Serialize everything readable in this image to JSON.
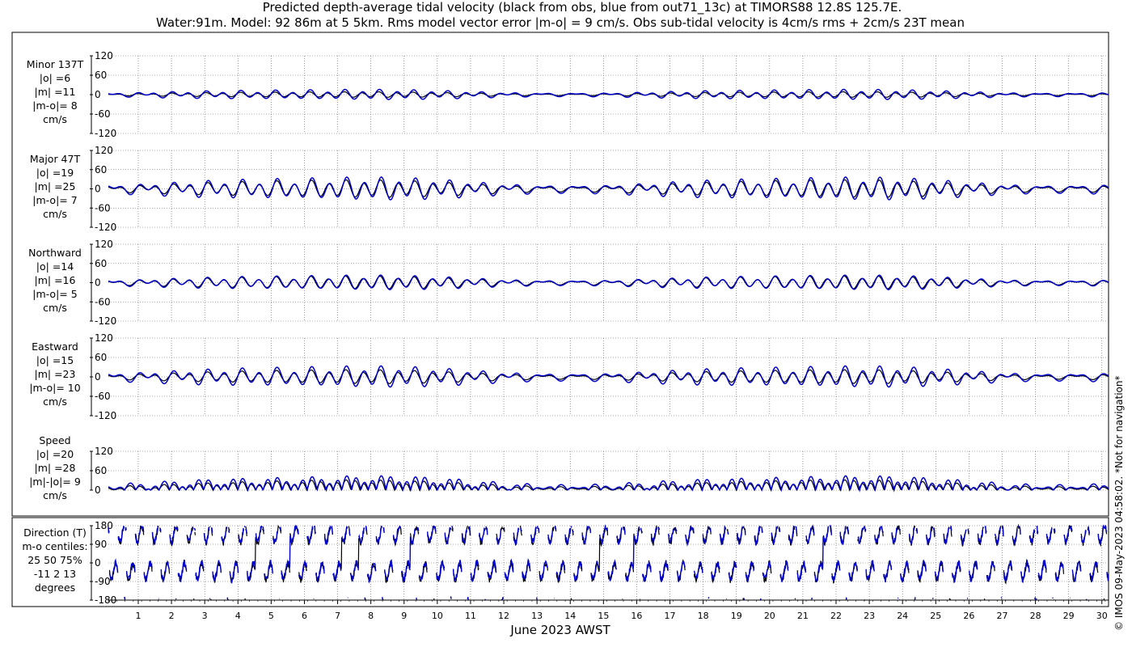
{
  "title_line1": "Predicted depth-average tidal velocity (black from obs, blue from out71_13c) at TIMORS88 12.8S 125.7E.",
  "title_line2": "Water:91m. Model: 92 86m at 5 5km. Rms model vector error |m-o| = 9 cm/s. Obs sub-tidal velocity is 4cm/s rms + 2cm/s 23T mean",
  "side_note": "© IMOS 09-May-2023 04:58:02. *Not for navigation*",
  "colors": {
    "obs": "#000000",
    "model": "#0000cc",
    "grid": "#555555"
  },
  "chart_data": {
    "type": "line",
    "xlabel": "June 2023 AWST",
    "x_range_days": [
      0.1,
      30.2
    ],
    "x_ticks": [
      "1",
      "2",
      "3",
      "4",
      "5",
      "6",
      "7",
      "8",
      "9",
      "10",
      "11",
      "12",
      "13",
      "14",
      "15",
      "16",
      "17",
      "18",
      "19",
      "20",
      "21",
      "22",
      "23",
      "24",
      "25",
      "26",
      "27",
      "28",
      "29",
      "30"
    ],
    "series_names": [
      "obs",
      "out71_13c"
    ],
    "panels": [
      {
        "key": "minor",
        "label_lines": [
          "Minor 137T",
          "|o| =6",
          "|m| =11",
          "|m-o|= 8",
          "cm/s"
        ],
        "ylim": [
          -120,
          120
        ],
        "yticks": [
          "120",
          "60",
          "0",
          "-60",
          "-120"
        ],
        "obs_amp": 6,
        "model_amp": 11
      },
      {
        "key": "major",
        "label_lines": [
          "Major 47T",
          "|o| =19",
          "|m| =25",
          "|m-o|= 7",
          "cm/s"
        ],
        "ylim": [
          -120,
          120
        ],
        "yticks": [
          "120",
          "60",
          "0",
          "-60",
          "-120"
        ],
        "obs_amp": 19,
        "model_amp": 25
      },
      {
        "key": "north",
        "label_lines": [
          "Northward",
          "|o| =14",
          "|m| =16",
          "|m-o|= 5",
          "cm/s"
        ],
        "ylim": [
          -120,
          120
        ],
        "yticks": [
          "120",
          "60",
          "0",
          "-60",
          "-120"
        ],
        "obs_amp": 14,
        "model_amp": 16
      },
      {
        "key": "east",
        "label_lines": [
          "Eastward",
          "|o| =15",
          "|m| =23",
          "|m-o|= 10",
          "cm/s"
        ],
        "ylim": [
          -120,
          120
        ],
        "yticks": [
          "120",
          "60",
          "0",
          "-60",
          "-120"
        ],
        "obs_amp": 15,
        "model_amp": 23
      },
      {
        "key": "speed",
        "label_lines": [
          "Speed",
          "|o| =20",
          "|m| =28",
          "|m|-|o|= 9",
          "cm/s"
        ],
        "ylim": [
          0,
          120
        ],
        "yticks": [
          "120",
          "60",
          "0"
        ],
        "obs_amp": 20,
        "model_amp": 28
      },
      {
        "key": "direction",
        "label_lines": [
          "Direction (T)",
          "m-o centiles:",
          "25  50  75%",
          "-11   2  13",
          "degrees"
        ],
        "ylim": [
          -180,
          180
        ],
        "yticks": [
          "180",
          "90",
          "0",
          "-90",
          "-180"
        ]
      }
    ]
  }
}
